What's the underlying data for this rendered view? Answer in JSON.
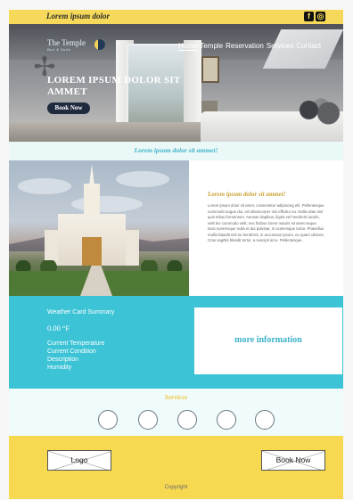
{
  "topbar": {
    "tagline": "Lorem ipsum dolor",
    "social": [
      "facebook-icon",
      "instagram-icon"
    ]
  },
  "logo": {
    "name": "The Temple",
    "sub": "Bed & Suite"
  },
  "nav": {
    "items": [
      "Home",
      "Temple",
      "Reservation",
      "Services",
      "Contact"
    ],
    "active": "Home"
  },
  "hero": {
    "title": "LOREM IPSUM DOLOR SIT AMMET",
    "button": "Book Now"
  },
  "strip": {
    "text": "Lorem ipsum dolor sit ammet!"
  },
  "about": {
    "title": "Lorem ipsum dolor sit ammet!",
    "body": "Lorem ipsum dolor sit amet, consectetur adipiscing elit. Pellentesque commodo augue dui, vel ullamcorper nisi efficitur eu. Nulla vitae nisl quis tellus fermentum. Aenean dapibus, ligula vel hendrerit iaculis, velit leo commodo velit, nec finibus lorem mauris sit amet neque. Duis scelerisque nulla et dui pulvinar, in scelerisque tortor. Phasellus mollis blandit nisl eu hendrerit, in accumsan ipsum, eu quam ultrices. Cras sagittis blandit tortor, a suscipit arcu. Pellentesque."
  },
  "weather": {
    "title": "Weather Card Summary",
    "temp": "0.00 °F",
    "rows": [
      "Current Temperature",
      "Current Condition",
      "Description",
      "Humidity"
    ]
  },
  "more": {
    "text": "more information"
  },
  "services": {
    "title": "Services",
    "count": 5
  },
  "footer": {
    "logo_label": "Logo",
    "book_label": "Book Now",
    "copyright": "Copyright"
  },
  "colors": {
    "accent_yellow": "#f6d95a",
    "accent_teal": "#3cc3d6",
    "heading_teal": "#3bb2c8",
    "heading_gold": "#c9a233",
    "button_navy": "#1f2a3e"
  }
}
